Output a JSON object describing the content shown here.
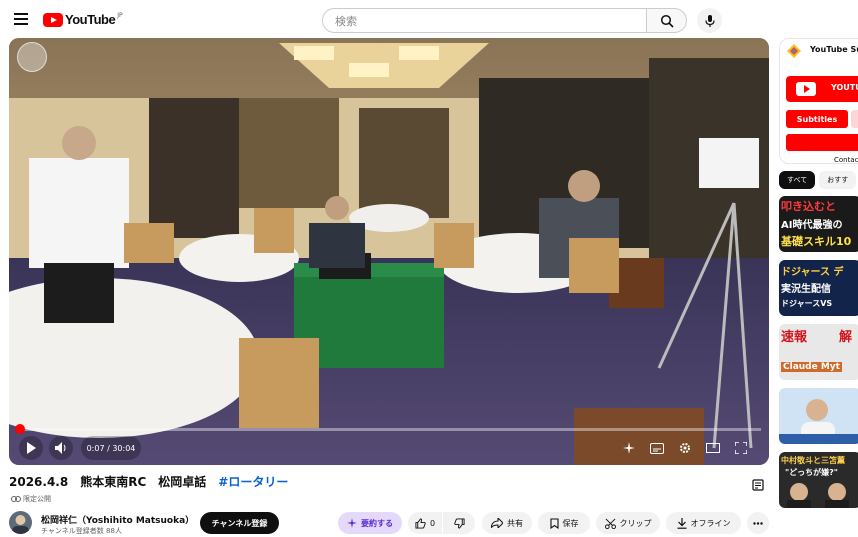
{
  "header": {
    "logo_text": "YouTube",
    "logo_region": "JP",
    "search_placeholder": "検索"
  },
  "player": {
    "current_time": "0:07",
    "duration": "30:04",
    "time_display": "0:07 / 30:04",
    "progress_percent": 0.4
  },
  "video": {
    "title_main": "2026.4.8　熊本東南RC　松岡卓話　",
    "hashtag": "#ロータリー",
    "visibility": "限定公開"
  },
  "channel": {
    "name": "松岡祥仁（Yoshihito Matsuoka）",
    "subscribers": "チャンネル登録者数 88人",
    "subscribe_label": "チャンネル登録"
  },
  "actions": {
    "join": "要約する",
    "likes": "0",
    "share": "共有",
    "save": "保存",
    "clip": "クリップ",
    "offline": "オフライン"
  },
  "sidebar": {
    "ad_title": "YouTube Su",
    "ad_subtitles": "Subtitles",
    "ad_contact": "Contac",
    "chips": [
      "すべて",
      "おすす"
    ],
    "thumb1_lines": [
      "叩き込むと",
      "AI時代最強の",
      "基礎スキル10"
    ],
    "thumb2_lines": [
      "ドジャース デ",
      "実況生配信",
      "ドジャースVS"
    ],
    "thumb3_lines": [
      "速報",
      "解",
      "Claude Myt"
    ],
    "thumb5_lines": [
      "中村敬斗と三笘薫",
      "\"どっちが嫌?\""
    ]
  },
  "colors": {
    "brand_red": "#ff0000",
    "link_blue": "#065fd4",
    "join_purple": "#5b2bd1"
  }
}
